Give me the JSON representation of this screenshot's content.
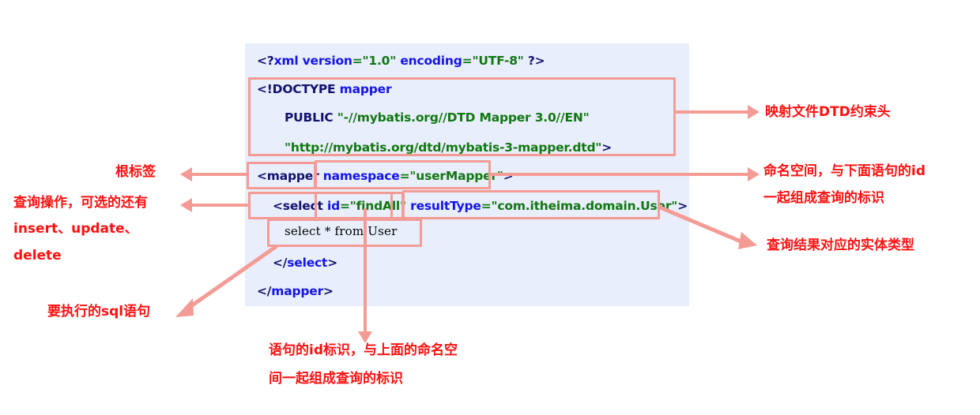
{
  "diagram": {
    "title": "MyBatis mapper XML annotated diagram",
    "colors": {
      "code_panel_bg": "#e8eefb",
      "highlight_box": "#f49b95",
      "annotation_text": "#ff1111",
      "tag_navy": "#12126e",
      "attr_blue": "#1414e6",
      "value_green": "#1a7a1a"
    }
  },
  "code": {
    "line1": {
      "p1": "<?",
      "p2": "xml version",
      "p3": "=\"1.0\" ",
      "p4": "encoding",
      "p5": "=\"UTF-8\" ",
      "p6": "?>"
    },
    "line2": {
      "p1": "<!DOCTYPE ",
      "p2": "mapper"
    },
    "line3": {
      "p1": "PUBLIC ",
      "p2": "\"-//mybatis.org//DTD Mapper 3.0//EN\""
    },
    "line4": {
      "p1": "\"http://mybatis.org/dtd/mybatis-3-mapper.dtd\"",
      "p2": ">"
    },
    "line5": {
      "p1": "<mapper ",
      "p2": "namespace",
      "p3": "=\"userMapper\"",
      "p4": ">"
    },
    "line6": {
      "p1": "<select ",
      "p2": "id",
      "p3": "=\"findAll\" ",
      "p4": "resultType",
      "p5": "=\"com.itheima.domain.User\"",
      "p6": ">"
    },
    "line7": {
      "p1": "select * from User"
    },
    "line8": {
      "p1": "</",
      "p2": "select",
      "p3": ">"
    },
    "line9": {
      "p1": "</",
      "p2": "mapper",
      "p3": ">"
    }
  },
  "annotations": {
    "dtd_header": "映射文件DTD约束头",
    "namespace_line1": "命名空间，与下面语句的id",
    "namespace_line2": "一起组成查询的标识",
    "result_type": "查询结果对应的实体类型",
    "root_tag": "根标签",
    "query_op_line1": "查询操作，可选的还有",
    "query_op_line2": "insert、update、",
    "query_op_line3": "delete",
    "sql_to_run": "要执行的sql语句",
    "id_line1": "语句的id标识，与上面的命名空",
    "id_line2": "间一起组成查询的标识"
  }
}
